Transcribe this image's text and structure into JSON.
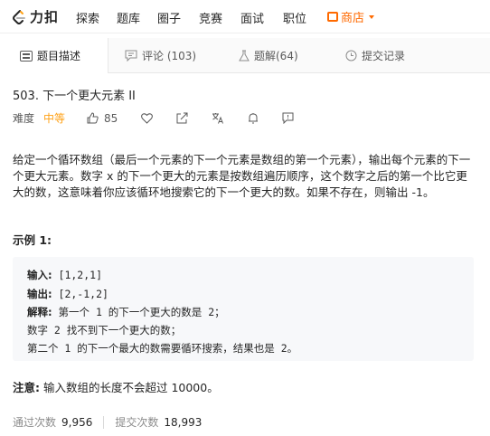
{
  "nav": {
    "logo_text": "力扣",
    "items": [
      "探索",
      "题库",
      "圈子",
      "竞赛",
      "面试",
      "职位"
    ],
    "shop_label": "商店"
  },
  "tabs": [
    {
      "label": "题目描述",
      "icon": "document-icon",
      "active": true
    },
    {
      "label": "评论 (103)",
      "icon": "comment-icon",
      "active": false
    },
    {
      "label": "题解(64)",
      "icon": "flask-icon",
      "active": false
    },
    {
      "label": "提交记录",
      "icon": "clock-icon",
      "active": false
    }
  ],
  "problem": {
    "title": "503. 下一个更大元素 II",
    "difficulty_label": "难度",
    "difficulty": "中等",
    "likes": "85",
    "description": "给定一个循环数组（最后一个元素的下一个元素是数组的第一个元素），输出每个元素的下一个更大元素。数字 x 的下一个更大的元素是按数组遍历顺序，这个数字之后的第一个比它更大的数，这意味着你应该循环地搜索它的下一个更大的数。如果不存在，则输出 -1。",
    "example_title": "示例 1:",
    "example": {
      "input_label": "输入:",
      "input": " [1,2,1]",
      "output_label": "输出:",
      "output": " [2,-1,2]",
      "explain_label": "解释:",
      "explain1": " 第一个 1 的下一个更大的数是 2；",
      "explain2": "数字 2 找不到下一个更大的数；",
      "explain3": "第二个 1 的下一个最大的数需要循环搜索，结果也是 2。"
    },
    "note_label": "注意:",
    "note": " 输入数组的长度不会超过 10000。"
  },
  "stats": {
    "accepted_label": "通过次数",
    "accepted": "9,956",
    "submitted_label": "提交次数",
    "submitted": "18,993"
  },
  "colors": {
    "accent": "#ffa116",
    "shop": "#ff6a00"
  }
}
